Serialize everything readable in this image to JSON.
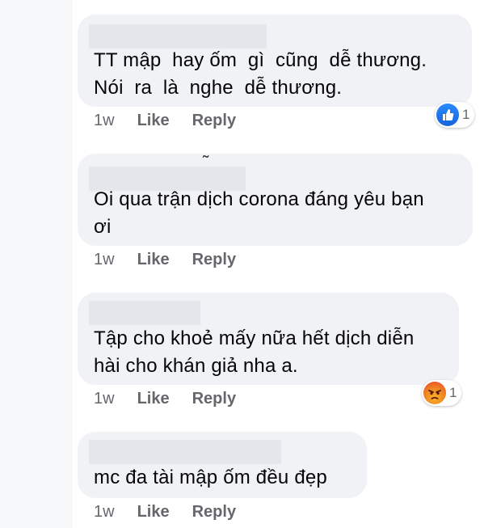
{
  "comments": [
    {
      "text": "TT mập  hay ốm  gì  cũng  dễ thương.\nNói  ra  là  nghe  dễ thương.",
      "time": "1w",
      "like_label": "Like",
      "reply_label": "Reply",
      "reaction": {
        "icon": "like-icon",
        "count": "1"
      }
    },
    {
      "name_mark": "˜",
      "text": "Oi qua trận dịch corona đáng yêu bạn\nơi",
      "time": "1w",
      "like_label": "Like",
      "reply_label": "Reply"
    },
    {
      "text": "Tập cho khoẻ mấy nữa hết dịch diễn\nhài cho khán giả nha a.",
      "time": "1w",
      "like_label": "Like",
      "reply_label": "Reply",
      "reaction": {
        "icon": "angry-icon",
        "count": "1"
      }
    },
    {
      "text": "mc đa tài mập ốm đều đẹp",
      "time": "1w",
      "like_label": "Like",
      "reply_label": "Reply"
    }
  ],
  "colors": {
    "bubble": "#f0f2f5",
    "meta_text": "#65676b",
    "like_blue": "#1877f2",
    "angry_orange": "#f08a24"
  }
}
